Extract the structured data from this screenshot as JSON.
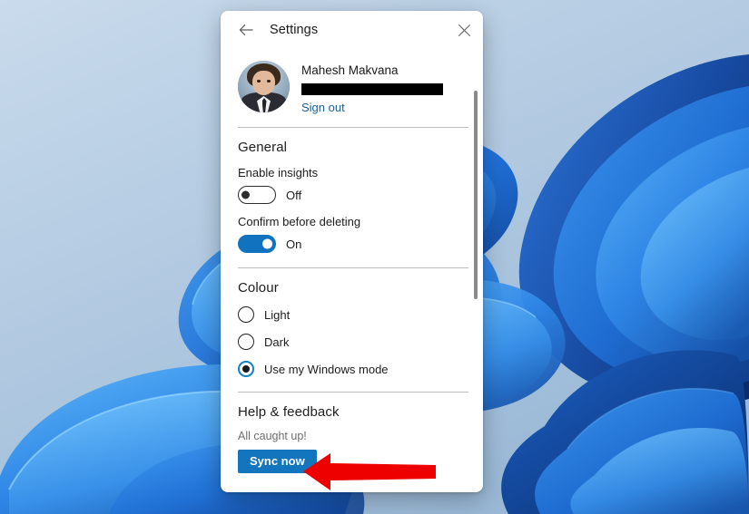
{
  "window": {
    "title": "Settings",
    "back_icon": "back-arrow-icon",
    "close_icon": "close-icon"
  },
  "account": {
    "name": "Mahesh Makvana",
    "email_redacted": "",
    "sign_out_label": "Sign out",
    "avatar_alt": "user-avatar"
  },
  "sections": {
    "general": {
      "heading": "General",
      "settings": [
        {
          "label": "Enable insights",
          "state": "Off",
          "on": false
        },
        {
          "label": "Confirm before deleting",
          "state": "On",
          "on": true
        }
      ]
    },
    "colour": {
      "heading": "Colour",
      "options": [
        {
          "label": "Light",
          "selected": false
        },
        {
          "label": "Dark",
          "selected": false
        },
        {
          "label": "Use my Windows mode",
          "selected": true
        }
      ]
    },
    "help": {
      "heading": "Help & feedback",
      "status": "All caught up!",
      "sync_button_label": "Sync now"
    }
  },
  "annotation": {
    "type": "arrow",
    "direction": "left",
    "color": "#ee0000",
    "points_at": "Sync now"
  },
  "colors": {
    "accent": "#1375bd",
    "link": "#14619b",
    "toggle_on": "#1173c0",
    "radio_selected_ring": "#0a84c8",
    "annotation_red": "#ee0000",
    "dialog_bg": "#ffffff",
    "divider": "#bdbdbd",
    "muted_text": "#6d6d6d",
    "wallpaper_sky": "#b8cfe4",
    "wallpaper_blue": "#2b7fe0"
  }
}
